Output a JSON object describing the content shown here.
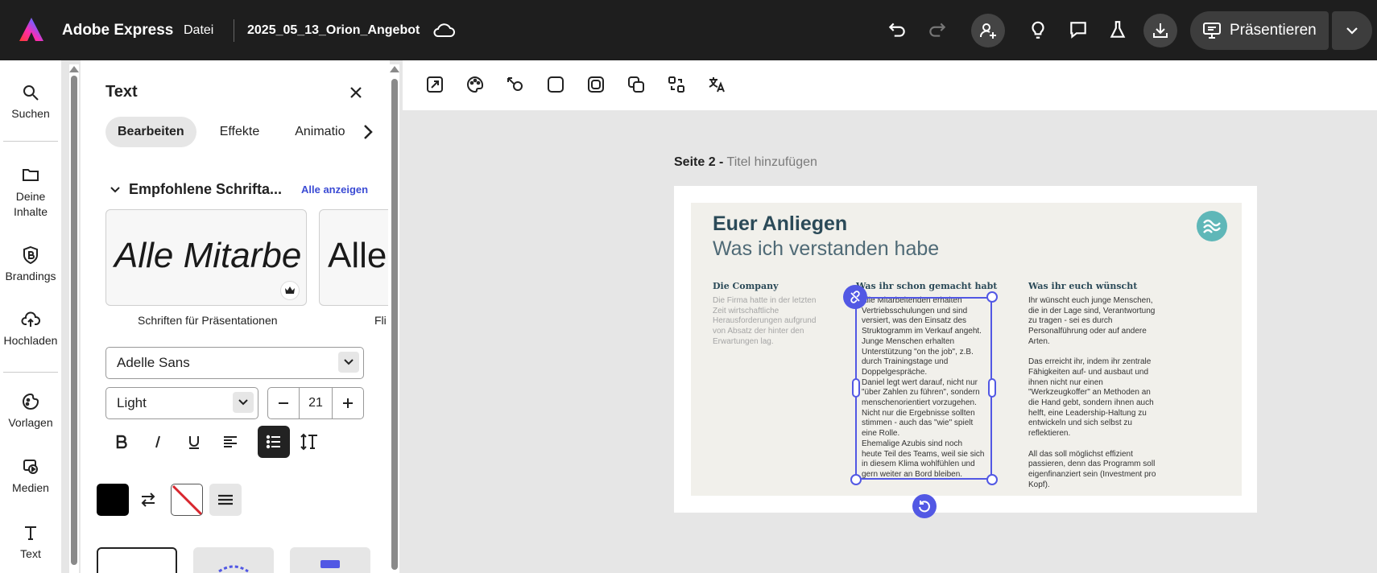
{
  "topbar": {
    "app_name": "Adobe Express",
    "file_menu": "Datei",
    "document_name": "2025_05_13_Orion_Angebot",
    "present_label": "Präsentieren"
  },
  "rail": {
    "search": "Suchen",
    "content": "Deine Inhalte",
    "brandings": "Brandings",
    "upload": "Hochladen",
    "templates": "Vorlagen",
    "media": "Medien",
    "text": "Text"
  },
  "panel": {
    "title": "Text",
    "tabs": [
      "Bearbeiten",
      "Effekte",
      "Animation"
    ],
    "section_title": "Empfohlene Schrifta...",
    "see_all": "Alle anzeigen",
    "font_cards": [
      {
        "preview": "Alle Mitarbe",
        "label": "Schriften für Präsentationen"
      },
      {
        "preview": "Alle",
        "label": "Fli"
      }
    ],
    "font_family": "Adelle Sans",
    "font_weight": "Light",
    "font_size": "21",
    "text_color": "#000000"
  },
  "canvas": {
    "page_label": "Seite 2 -",
    "page_title_placeholder": "Titel hinzufügen"
  },
  "slide": {
    "title": "Euer Anliegen",
    "subtitle": "Was ich verstanden habe",
    "columns": [
      {
        "heading": "Die Company",
        "body": "Die Firma hatte in der letzten\nZeit wirtschaftliche\nHerausforderungen aufgrund\nvon Absatz der hinter den\nErwartungen lag."
      },
      {
        "heading": "Was ihr schon gemacht habt",
        "body": "Alle Mitarbeitenden erhalten\nVertriebsschulungen und sind\nversiert, was den Einsatz des\nStruktogramm im Verkauf angeht.\nJunge Menschen erhalten\nUnterstützung \"on the job\", z.B.\ndurch Trainingstage und\nDoppelgespräche.\nDaniel legt wert darauf, nicht nur\n\"über Zahlen zu führen\", sondern\nmenschenorientiert vorzugehen.\nNicht nur die Ergebnisse sollten\nstimmen - auch das \"wie\" spielt\neine Rolle.\nEhemalige Azubis sind noch\nheute Teil des Teams, weil sie sich\nin diesem Klima wohlfühlen und\ngern weiter an Bord bleiben."
      },
      {
        "heading": "Was ihr euch wünscht",
        "body": "Ihr wünscht euch junge Menschen,\ndie in der Lage sind, Verantwortung\nzu tragen - sei es durch\nPersonalführung oder auf andere\nArten.\n\nDas erreicht ihr, indem ihr zentrale\nFähigkeiten auf- und ausbaut und\nihnen nicht nur einen\n\"Werkzeugkoffer\" an Methoden an\ndie Hand gebt, sondern ihnen auch\nhelft, eine Leadership-Haltung zu\nentwickeln und sich selbst zu\nreflektieren.\n\nAll das soll möglichst effizient\npassieren, denn das Programm soll\neigenfinanziert sein (Investment pro\nKopf)."
      }
    ]
  },
  "colors": {
    "accent": "#5258e4",
    "topbar": "#1e1e1e",
    "slide_bg": "#f1f0eb",
    "slide_title": "#2b4a58",
    "logo_teal": "#5fb7b8"
  }
}
